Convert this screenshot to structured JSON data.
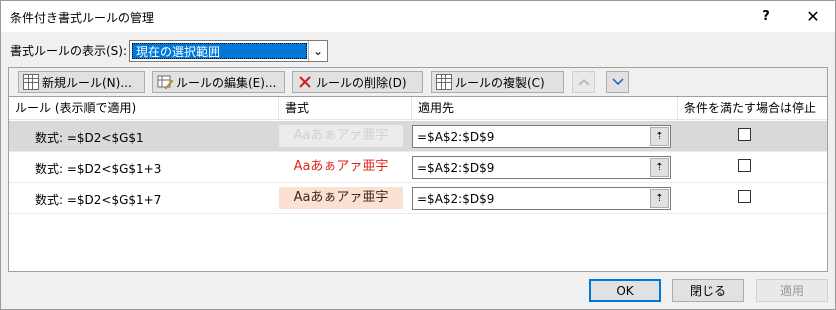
{
  "window": {
    "title": "条件付き書式ルールの管理",
    "help_glyph": "?",
    "close_glyph": "✕"
  },
  "show_rules": {
    "label": "書式ルールの表示(S):",
    "selected": "現在の選択範囲",
    "arrow_glyph": "⌄"
  },
  "toolbar": {
    "new_rule": "新規ルール(N)...",
    "edit_rule": "ルールの編集(E)...",
    "delete_rule": "ルールの削除(D)",
    "duplicate_rule": "ルールの複製(C)",
    "up_glyph": "⌃",
    "down_glyph": "⌄"
  },
  "table": {
    "columns": [
      "ルール (表示順で適用)",
      "書式",
      "適用先",
      "条件を満たす場合は停止"
    ],
    "rows": [
      {
        "rule": "数式: =$D2<$G$1",
        "preview": "Aaあぁアァ亜宇",
        "preview_color": "#d0d0d0",
        "preview_bg": "#ececec",
        "applies_to": "=$A$2:$D$9",
        "stop_if_true": false,
        "selected": true
      },
      {
        "rule": "数式: =$D2<$G$1+3",
        "preview": "Aaあぁアァ亜宇",
        "preview_color": "#e0241c",
        "preview_bg": "#ffffff",
        "applies_to": "=$A$2:$D$9",
        "stop_if_true": false,
        "selected": false
      },
      {
        "rule": "数式: =$D2<$G$1+7",
        "preview": "Aaあぁアァ亜宇",
        "preview_color": "#3a2a20",
        "preview_bg": "#fbe1d3",
        "applies_to": "=$A$2:$D$9",
        "stop_if_true": false,
        "selected": false
      }
    ],
    "ref_glyph": "⇡"
  },
  "buttons": {
    "ok": "OK",
    "close": "閉じる",
    "apply": "適用"
  },
  "colors": {
    "accent": "#0078d7",
    "delete_icon": "#d21f1f"
  }
}
